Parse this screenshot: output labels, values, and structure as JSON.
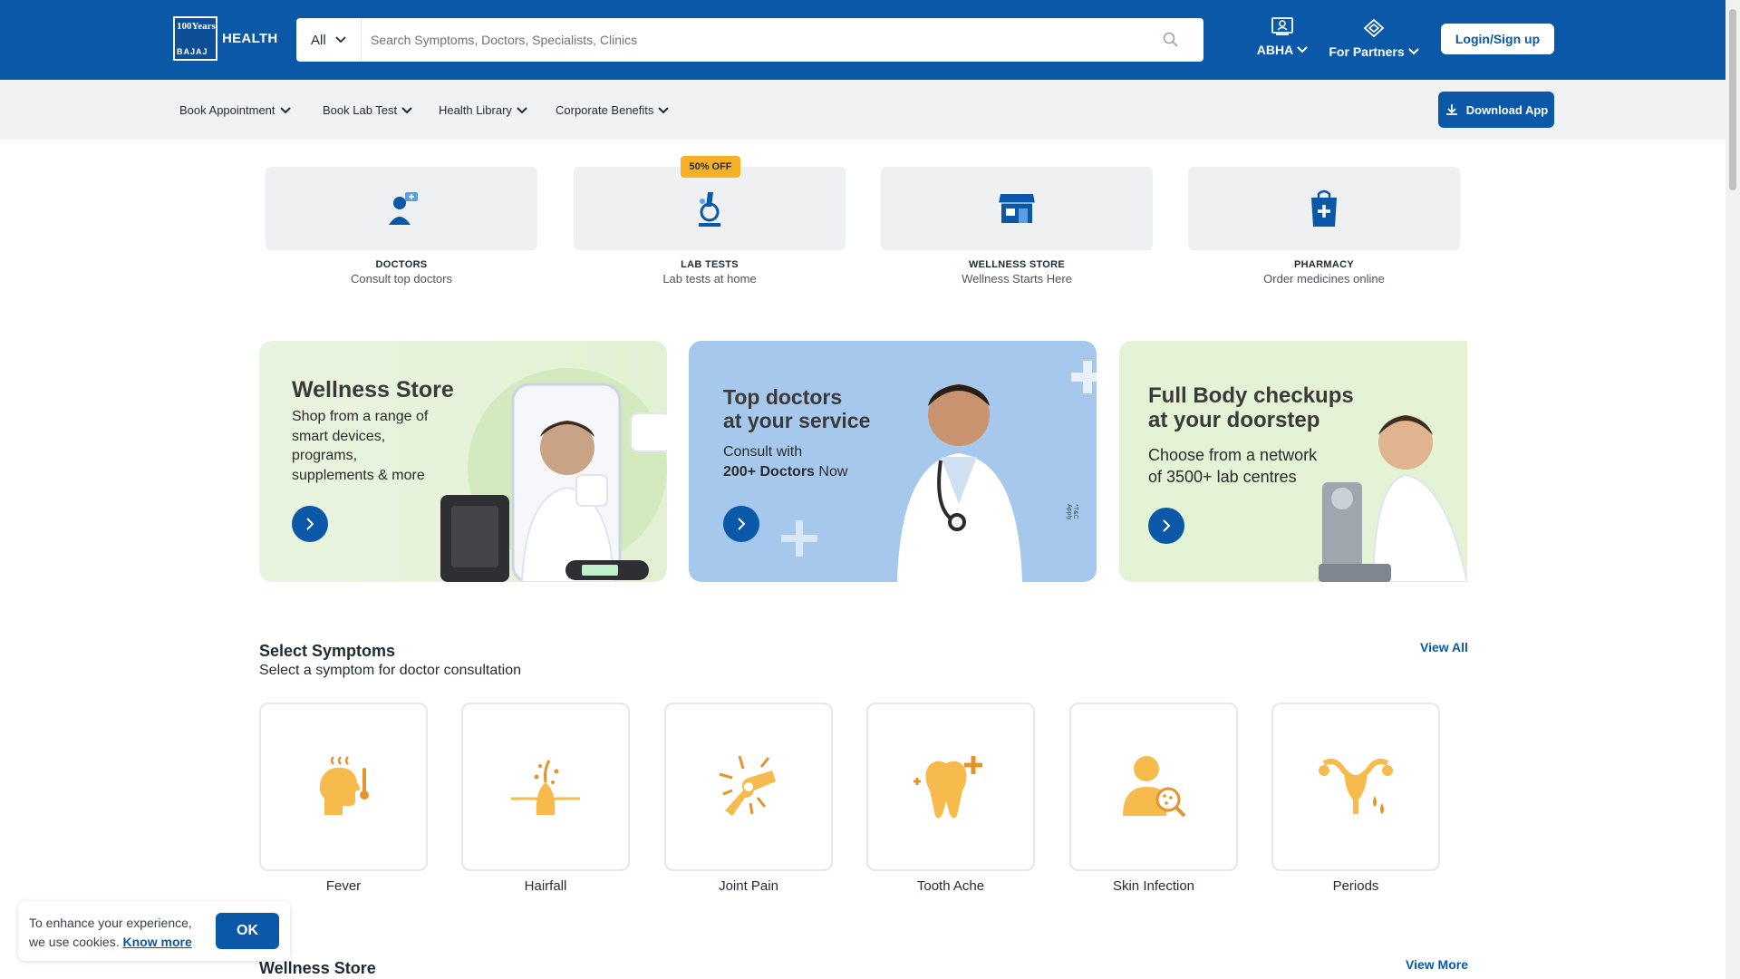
{
  "header": {
    "logo_top": "100Years",
    "logo_bottom": "BAJAJ",
    "logo_text": "HEALTH",
    "search_category": "All",
    "search_placeholder": "Search Symptoms, Doctors, Specialists, Clinics",
    "abha_label": "ABHA",
    "partners_label": "For Partners",
    "login_label": "Login/Sign up"
  },
  "nav": {
    "items": [
      {
        "label": "Book Appointment"
      },
      {
        "label": "Book Lab Test"
      },
      {
        "label": "Health Library"
      },
      {
        "label": "Corporate Benefits"
      }
    ],
    "download_label": "Download App"
  },
  "categories": [
    {
      "title": "DOCTORS",
      "subtitle": "Consult top doctors",
      "icon": "doctor-icon"
    },
    {
      "title": "LAB TESTS",
      "subtitle": "Lab tests at home",
      "icon": "microscope-icon",
      "badge": "50% OFF"
    },
    {
      "title": "WELLNESS STORE",
      "subtitle": "Wellness Starts Here",
      "icon": "store-icon"
    },
    {
      "title": "PHARMACY",
      "subtitle": "Order medicines online",
      "icon": "medicine-bag-icon"
    }
  ],
  "banners": [
    {
      "title": "Wellness Store",
      "text": "Shop from a range of smart devices, programs, supplements & more"
    },
    {
      "title_line1": "Top doctors",
      "title_line2": "at your service",
      "text_line1": "Consult with",
      "text_bold": "200+ Doctors",
      "text_after": " Now",
      "note": "*T&C Apply"
    },
    {
      "title_line1": "Full Body checkups",
      "title_line2": "at your doorstep",
      "text_line1": "Choose from a network",
      "text_line2": "of 3500+ lab centres"
    }
  ],
  "symptoms": {
    "title": "Select Symptoms",
    "subtitle": "Select a symptom for doctor consultation",
    "view_all": "View All",
    "items": [
      {
        "label": "Fever",
        "icon": "fever-icon"
      },
      {
        "label": "Hairfall",
        "icon": "hairfall-icon"
      },
      {
        "label": "Joint Pain",
        "icon": "joint-pain-icon"
      },
      {
        "label": "Tooth Ache",
        "icon": "tooth-icon"
      },
      {
        "label": "Skin Infection",
        "icon": "skin-infection-icon"
      },
      {
        "label": "Periods",
        "icon": "periods-icon"
      }
    ]
  },
  "wellness_section": {
    "title": "Wellness Store",
    "view_more": "View More"
  },
  "cookie": {
    "text": "To enhance your experience, we use cookies.",
    "link": "Know more",
    "ok": "OK"
  },
  "colors": {
    "brand_blue": "#0b58a8",
    "badge_orange": "#f5b027",
    "symptom_icon": "#f5b84a"
  }
}
